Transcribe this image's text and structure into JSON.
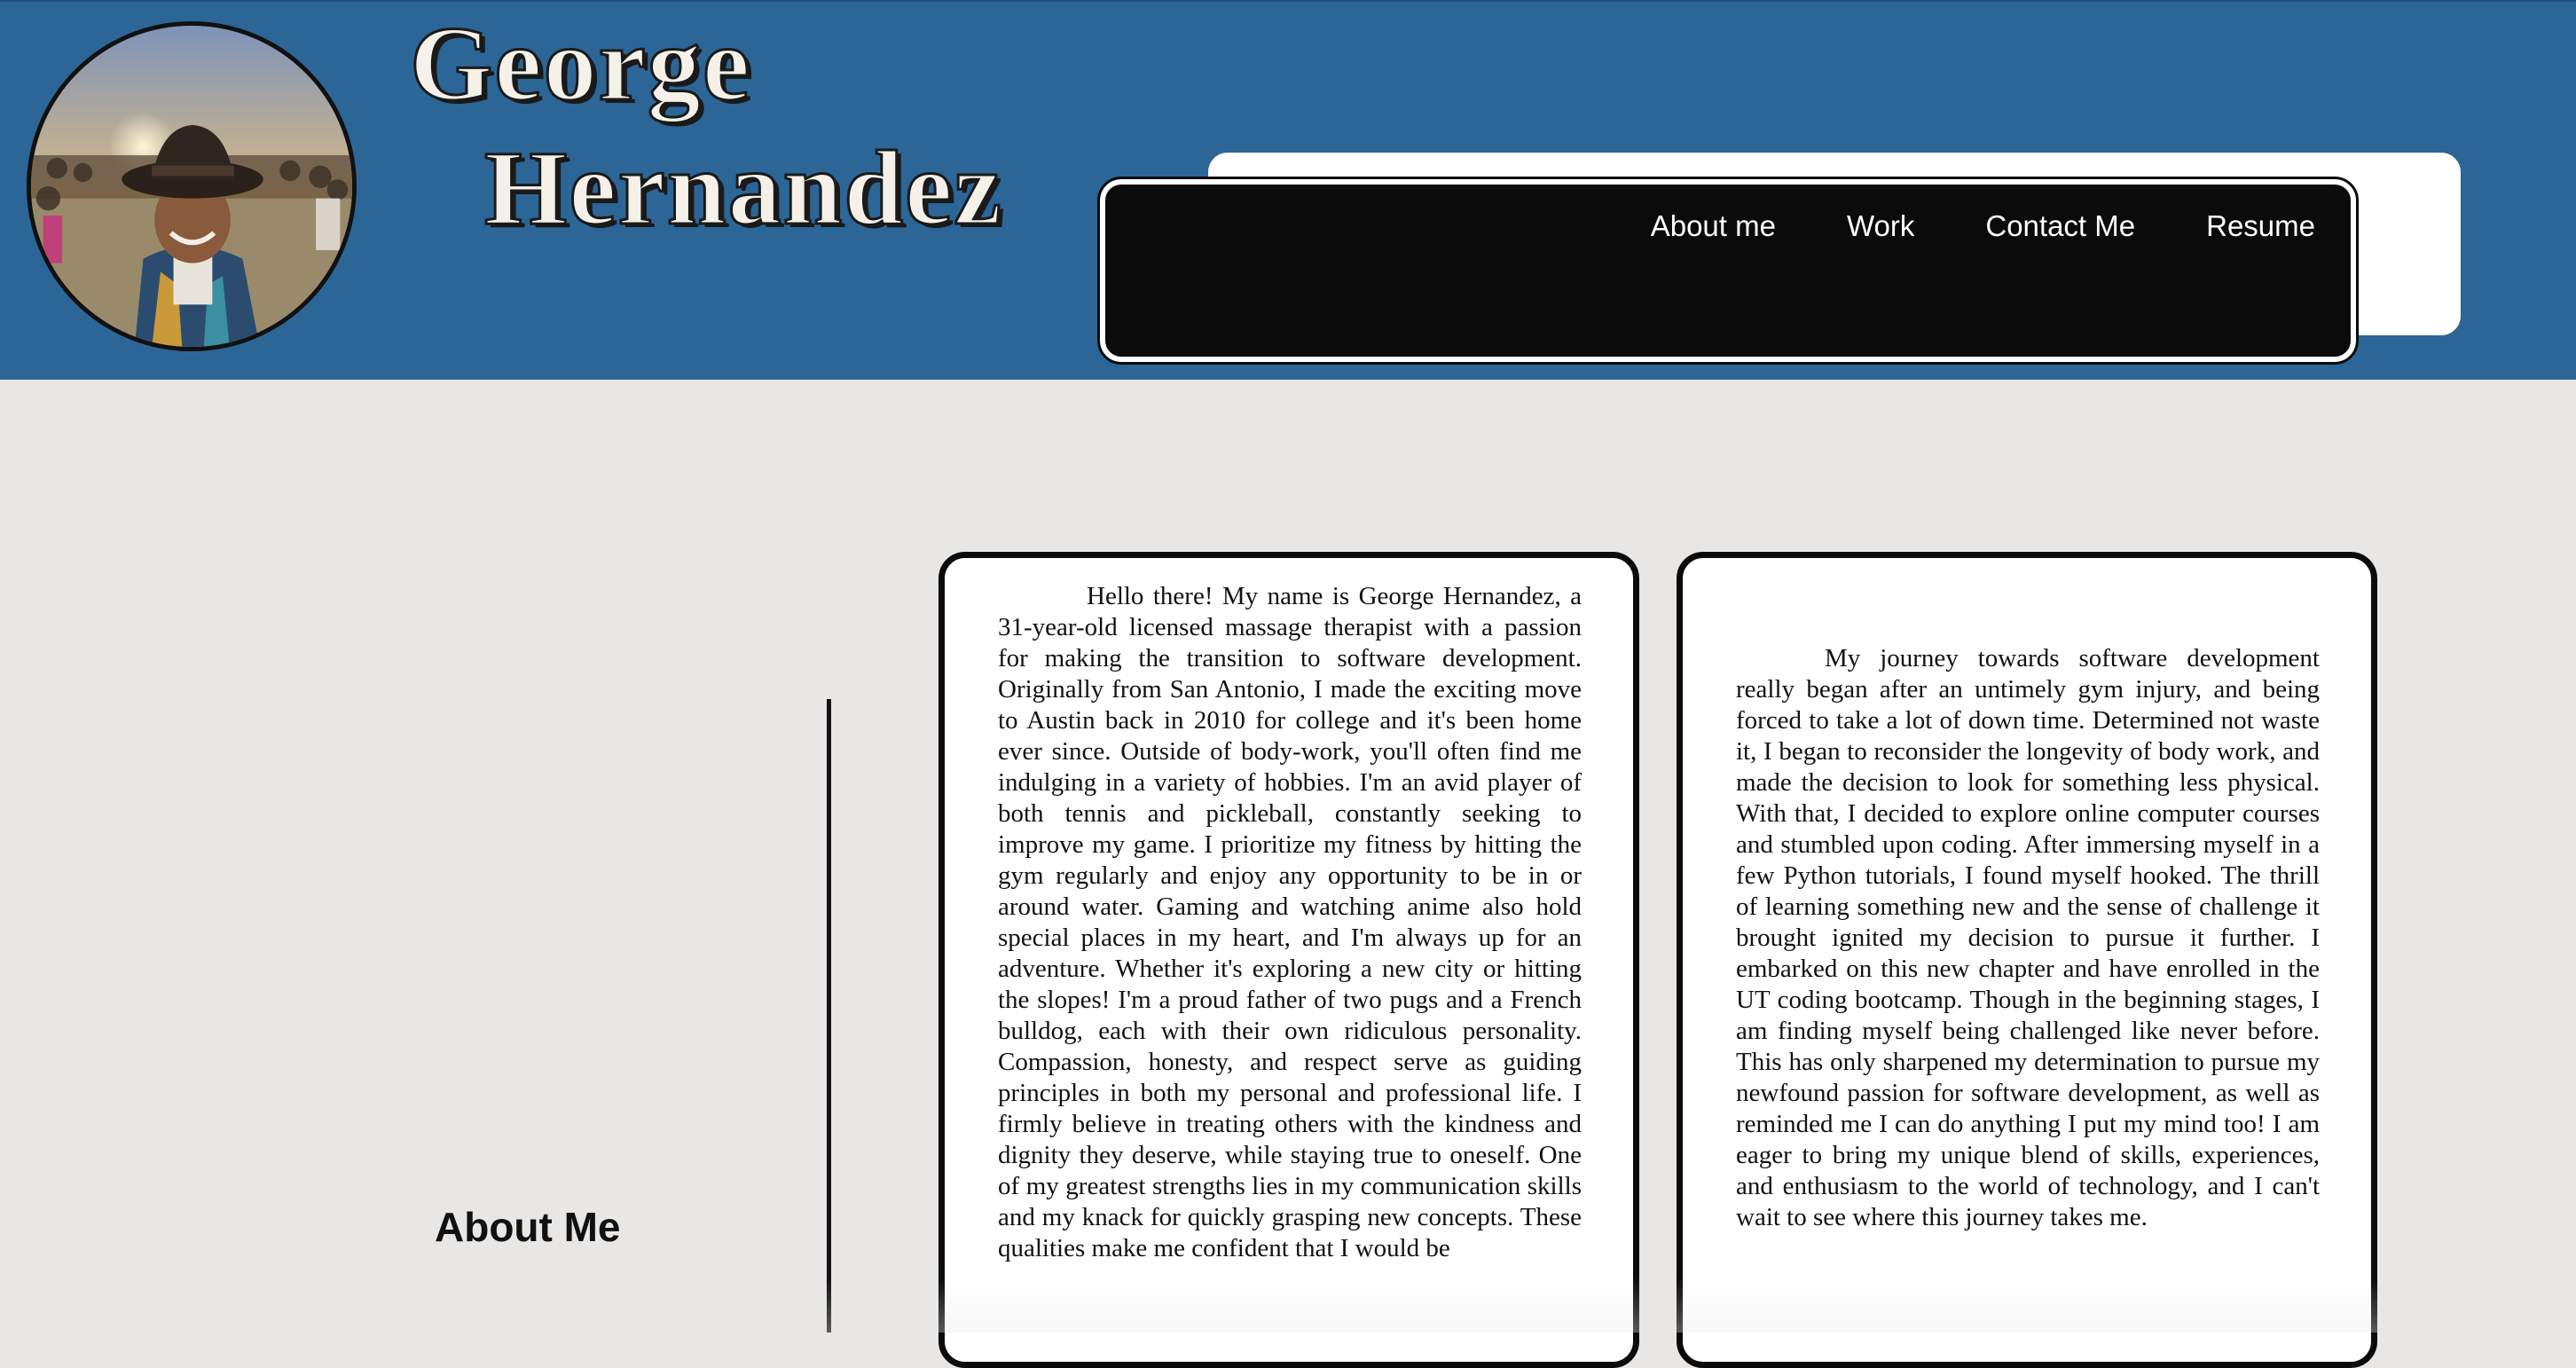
{
  "header": {
    "name_line1": "George",
    "name_line2": "Hernandez",
    "avatar_alt": "profile photo"
  },
  "nav": {
    "items": [
      {
        "label": "About me"
      },
      {
        "label": "Work"
      },
      {
        "label": "Contact Me"
      },
      {
        "label": "Resume"
      }
    ]
  },
  "about": {
    "heading": "About Me",
    "paragraph1": "Hello there! My name is George Hernandez, a 31-year-old licensed massage therapist with a passion for making the transition to software development. Originally from San Antonio, I made the exciting move to Austin back in 2010 for college and it's been home ever since. Outside of body-work, you'll often find me indulging in a variety of hobbies. I'm an avid player of both tennis and pickleball, constantly seeking to improve my game. I prioritize my fitness by hitting the gym regularly and enjoy any opportunity to be in or around water. Gaming and watching anime also hold special places in my heart, and I'm always up for an adventure. Whether it's exploring a new city or hitting the slopes! I'm a proud father of two pugs and a French bulldog, each with their own ridiculous personality. Compassion, honesty, and respect serve as guiding principles in both my personal and professional life. I firmly believe in treating others with the kindness and dignity they deserve, while staying true to oneself. One of my greatest strengths lies in my communication skills and my knack for quickly grasping new concepts. These qualities make me confident that I would be",
    "paragraph2": "My journey towards software development really began after an untimely gym injury, and being forced to take a lot of down time. Determined not waste it, I began to reconsider the longevity of body work, and made the decision to look for something less physical. With that, I decided to explore online computer courses and stumbled upon coding. After immersing myself in a few Python tutorials, I found myself hooked. The thrill of learning something new and the sense of challenge it brought ignited my decision to pursue it further. I embarked on this new chapter and have enrolled in the UT coding bootcamp. Though in the beginning stages, I am finding myself being challenged like never before. This has only sharpened my determination to pursue my newfound passion for software development, as well as reminded me I can do anything I put my mind too! I am eager to bring my unique blend of skills, experiences, and enthusiasm to the world of technology, and I can't wait to see where this journey takes me."
  },
  "colors": {
    "header_bg": "#2c6697",
    "page_bg": "#e8e7e5",
    "nav_bg": "#0b0b0b",
    "card_bg": "#ffffff"
  }
}
